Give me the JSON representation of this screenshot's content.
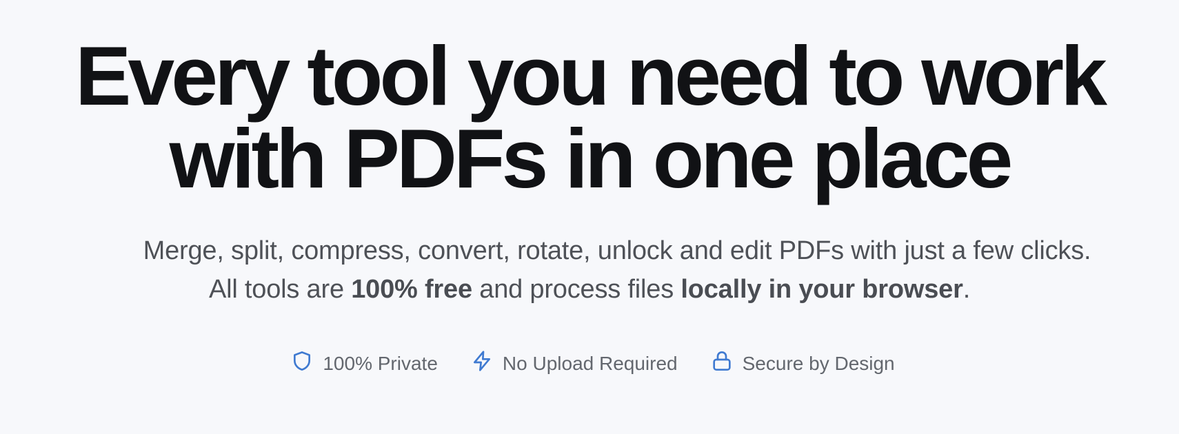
{
  "hero": {
    "headline": {
      "line1": "Every tool you need to work",
      "line2": "with PDFs in one place"
    },
    "subtitle": {
      "line1": "Merge, split, compress, convert, rotate, unlock and edit PDFs with just a few clicks.",
      "line2_part1": "All tools are ",
      "line2_bold1": "100% free",
      "line2_part2": " and process files ",
      "line2_bold2": "locally in your browser",
      "line2_part3": "."
    }
  },
  "features": [
    {
      "icon": "shield-icon",
      "label": "100% Private"
    },
    {
      "icon": "lightning-icon",
      "label": "No Upload Required"
    },
    {
      "icon": "lock-icon",
      "label": "Secure by Design"
    }
  ],
  "colors": {
    "background": "#f7f8fb",
    "headline": "#111215",
    "subtitle": "#4e5157",
    "feature_text": "#63676e",
    "icon_accent": "#3f7ad1"
  }
}
